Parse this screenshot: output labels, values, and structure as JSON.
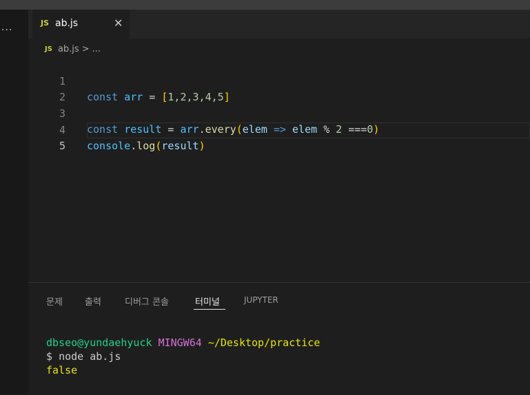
{
  "editor_tab": {
    "label": "ab.js",
    "badge": "JS",
    "close_glyph": "✕"
  },
  "activity": {
    "more_glyph": "···"
  },
  "breadcrumb": {
    "badge": "JS",
    "file": "ab.js",
    "separator": ">",
    "rest": "..."
  },
  "code_lines": [
    {
      "number": "1",
      "tokens": [
        "const",
        "arr",
        "=",
        "[",
        "1,2,3,4,5",
        "]"
      ]
    },
    {
      "number": "2"
    },
    {
      "number": "3",
      "tokens": [
        "const",
        "result",
        "=",
        "arr",
        ".",
        "every",
        "(",
        "elem",
        "=>",
        "elem",
        "%",
        "2",
        "===",
        "0",
        ")"
      ]
    },
    {
      "number": "4"
    },
    {
      "number": "5",
      "tokens": [
        "console",
        ".",
        "log",
        "(",
        "result",
        ")"
      ]
    }
  ],
  "panel_tabs": [
    "문제",
    "출력",
    "디버그 콘솔",
    "터미널",
    "JUPYTER"
  ],
  "active_panel_tab": "터미널",
  "terminal": {
    "user_host": "dbseo@yundaehyuck",
    "system": "MINGW64",
    "path": "~/Desktop/practice",
    "prompt": "$",
    "command": "node ab.js",
    "output": "false"
  }
}
